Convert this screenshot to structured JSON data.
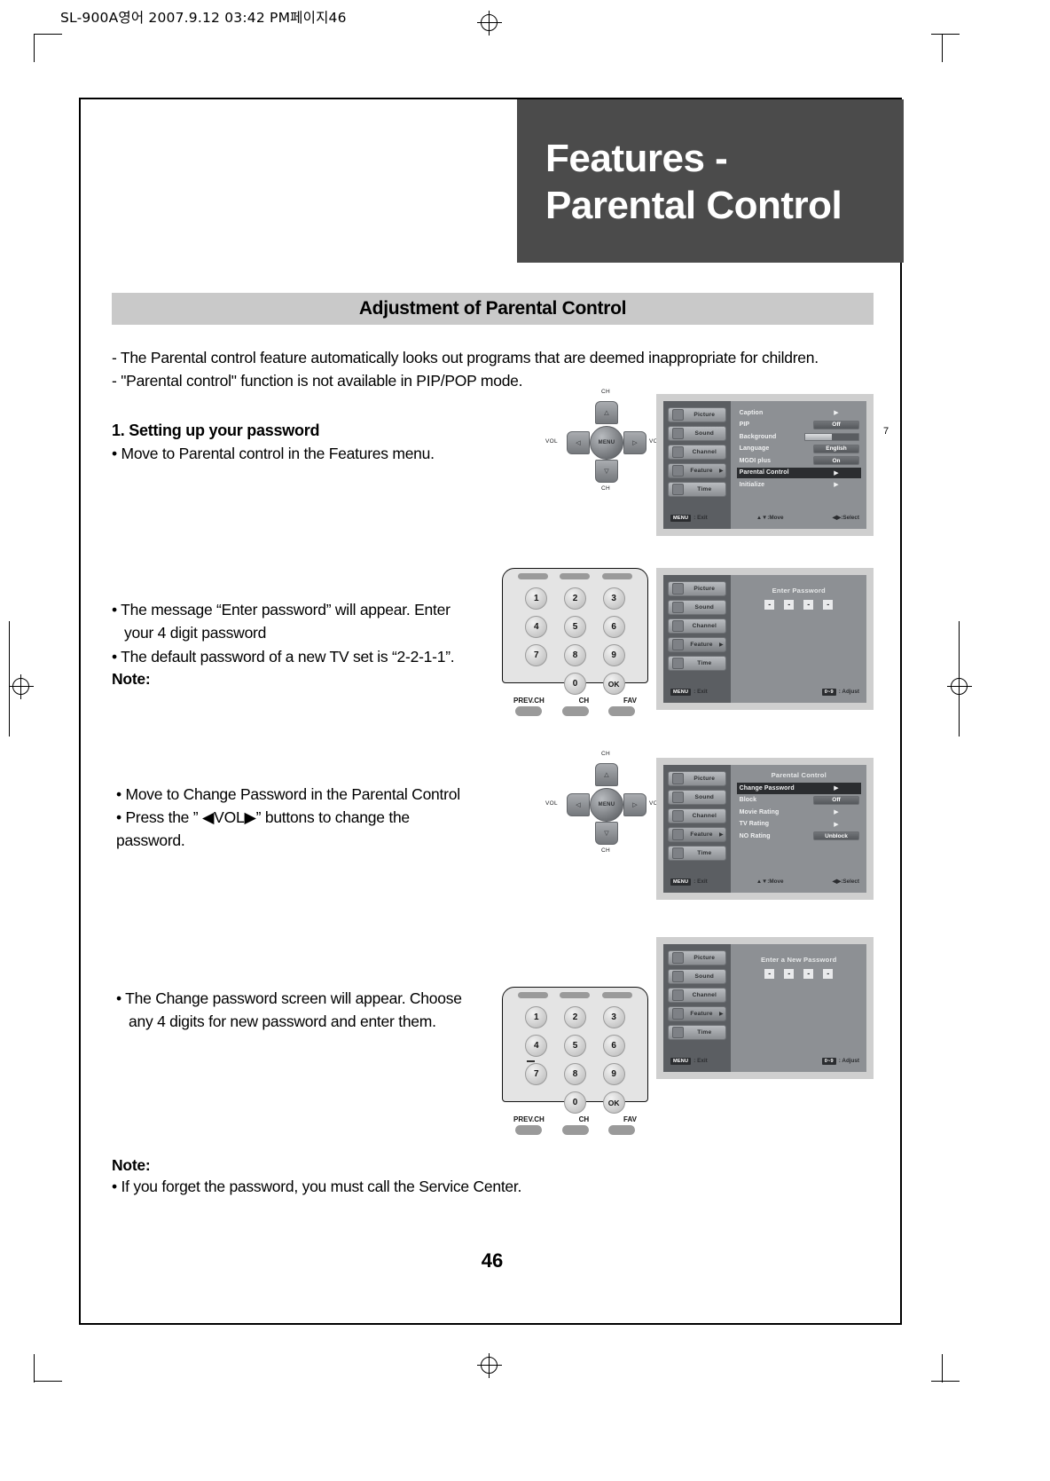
{
  "prolog": "SL-900A영어  2007.9.12 03:42 PM페이지46",
  "title": {
    "line1": "Features -",
    "line2": "Parental Control"
  },
  "section_heading": "Adjustment of Parental Control",
  "intro": {
    "line1": "- The Parental control feature automatically looks out programs that are deemed inappropriate for children.",
    "line2": "- \"Parental control\" function is not available in PIP/POP mode."
  },
  "step1": {
    "heading": "1. Setting up your password",
    "bullet": "• Move to Parental control in the Features menu."
  },
  "step2": {
    "bullet_line1": "• The message “Enter password” will appear. Enter",
    "bullet_line2": "your 4 digit password",
    "note_label": "Note:",
    "note_text": "• The default password of a new TV set is “2-2-1-1”."
  },
  "step3": {
    "line1": "• Move to Change Password in the Parental Control",
    "line2": "• Press the ” ◀VOL▶” buttons to change the",
    "line3": "password."
  },
  "step4": {
    "line1": "• The Change password screen will appear. Choose",
    "line2": "any 4 digits for new password and enter them."
  },
  "final_note": {
    "label": "Note:",
    "text": "• If you forget the password, you must call the Service Center."
  },
  "page_number": "46",
  "side_number": "7",
  "osd_sidebar": [
    {
      "label": "Picture",
      "icon": "monitor-icon"
    },
    {
      "label": "Sound",
      "icon": "speaker-icon"
    },
    {
      "label": "Channel",
      "icon": "tv-icon"
    },
    {
      "label": "Feature",
      "icon": "gear-icon"
    },
    {
      "label": "Time",
      "icon": "clock-icon"
    }
  ],
  "osd1": {
    "rows": [
      {
        "label": "Caption",
        "type": "arrow",
        "value": "▶"
      },
      {
        "label": "PIP",
        "type": "value",
        "value": "Off"
      },
      {
        "label": "Background",
        "type": "bar",
        "value": ""
      },
      {
        "label": "Language",
        "type": "value",
        "value": "English"
      },
      {
        "label": "MGDI plus",
        "type": "value",
        "value": "On"
      },
      {
        "label": "Parental Control",
        "type": "arrow",
        "value": "▶",
        "highlight": true
      },
      {
        "label": "Initialize",
        "type": "arrow",
        "value": "▶"
      }
    ],
    "help": {
      "key": "MENU",
      "exit": ": Exit",
      "move_icon": "▲▼",
      "move": " :Move",
      "select_icon": "◀▶",
      "select": " :Select"
    }
  },
  "osd2": {
    "title": "Enter Password",
    "digits": [
      "-",
      "-",
      "-",
      "-"
    ],
    "help": {
      "key": "MENU",
      "exit": ": Exit",
      "adjust_key": "0~9",
      "adjust": ": Adjust"
    }
  },
  "osd3": {
    "title": "Parental Control",
    "rows": [
      {
        "label": "Change Password",
        "type": "arrow",
        "value": "▶",
        "highlight": true
      },
      {
        "label": "Block",
        "type": "value",
        "value": "Off"
      },
      {
        "label": "Movie Rating",
        "type": "arrow",
        "value": "▶"
      },
      {
        "label": "TV Rating",
        "type": "arrow",
        "value": "▶"
      },
      {
        "label": "NO Rating",
        "type": "value",
        "value": "Unblock"
      }
    ],
    "help": {
      "key": "MENU",
      "exit": ": Exit",
      "move_icon": "▲▼",
      "move": " :Move",
      "select_icon": "◀▶",
      "select": " :Select"
    }
  },
  "osd4": {
    "title": "Enter a New Password",
    "digits": [
      "-",
      "-",
      "-",
      "-"
    ],
    "help": {
      "key": "MENU",
      "exit": ": Exit",
      "adjust_key": "0~9",
      "adjust": ": Adjust"
    }
  },
  "dpad": {
    "menu": "MENU",
    "up": "CH",
    "down": "CH",
    "left": "VOL",
    "right": "VOL",
    "glyph_up": "△",
    "glyph_down": "▽",
    "glyph_left": "◁",
    "glyph_right": "▷"
  },
  "keypad": {
    "keys": [
      "1",
      "2",
      "3",
      "4",
      "5",
      "6",
      "7",
      "8",
      "9",
      "",
      "0",
      "OK"
    ],
    "labels": [
      "PREV.CH",
      "CH",
      "FAV"
    ]
  }
}
